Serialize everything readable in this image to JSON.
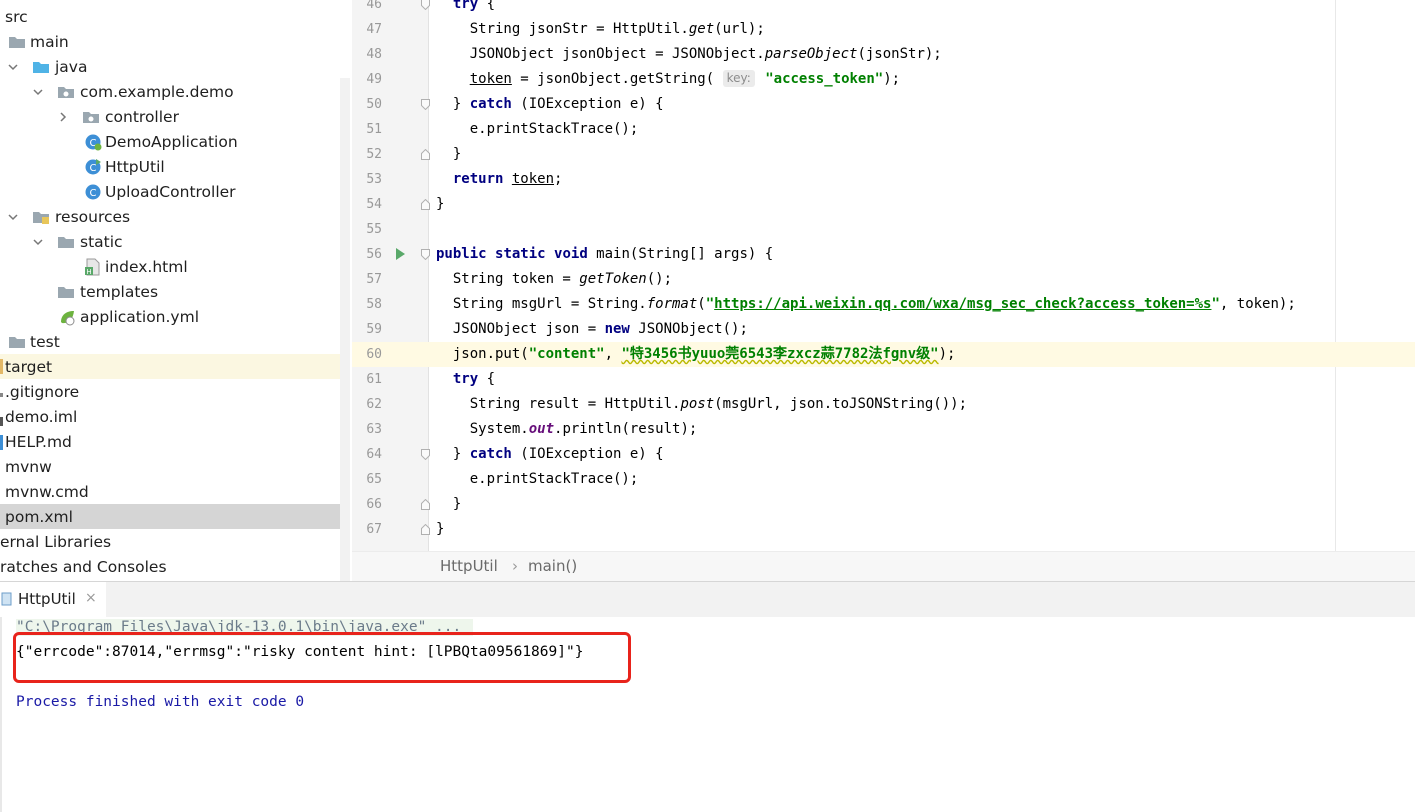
{
  "project_tree": {
    "items": [
      {
        "label": "src",
        "icon": "folder-icon",
        "arrow": ""
      },
      {
        "label": "main",
        "icon": "folder-icon",
        "arrow": ""
      },
      {
        "label": "java",
        "icon": "source-folder-icon",
        "arrow": "down"
      },
      {
        "label": "com.example.demo",
        "icon": "package-icon",
        "arrow": "down"
      },
      {
        "label": "controller",
        "icon": "package-icon",
        "arrow": "right"
      },
      {
        "label": "DemoApplication",
        "icon": "spring-class-icon",
        "arrow": ""
      },
      {
        "label": "HttpUtil",
        "icon": "runnable-class-icon",
        "arrow": ""
      },
      {
        "label": "UploadController",
        "icon": "class-icon",
        "arrow": ""
      },
      {
        "label": "resources",
        "icon": "resources-folder-icon",
        "arrow": "down"
      },
      {
        "label": "static",
        "icon": "folder-icon",
        "arrow": "down"
      },
      {
        "label": "index.html",
        "icon": "html-file-icon",
        "arrow": ""
      },
      {
        "label": "templates",
        "icon": "folder-icon",
        "arrow": ""
      },
      {
        "label": "application.yml",
        "icon": "yaml-file-icon",
        "arrow": ""
      },
      {
        "label": "test",
        "icon": "folder-icon",
        "arrow": ""
      },
      {
        "label": "target",
        "icon": "excluded-folder-icon",
        "arrow": ""
      },
      {
        "label": ".gitignore",
        "icon": "file-icon",
        "arrow": ""
      },
      {
        "label": "demo.iml",
        "icon": "module-file-icon",
        "arrow": ""
      },
      {
        "label": "HELP.md",
        "icon": "markdown-file-icon",
        "arrow": ""
      },
      {
        "label": "mvnw",
        "icon": "file-icon",
        "arrow": ""
      },
      {
        "label": "mvnw.cmd",
        "icon": "file-icon",
        "arrow": ""
      },
      {
        "label": "pom.xml",
        "icon": "maven-file-icon",
        "arrow": ""
      },
      {
        "label": "ernal Libraries",
        "icon": "library-icon",
        "arrow": ""
      },
      {
        "label": "ratches and Consoles",
        "icon": "scratch-icon",
        "arrow": ""
      }
    ]
  },
  "editor": {
    "current_line": "60",
    "lines": [
      {
        "num": "46",
        "text": "      try {"
      },
      {
        "num": "47",
        "text": "        String jsonStr = HttpUtil.get(url);"
      },
      {
        "num": "48",
        "text": "        JSONObject jsonObject = JSONObject.parseObject(jsonStr);"
      },
      {
        "num": "49",
        "text": "        token = jsonObject.getString( key: \"access_token\");"
      },
      {
        "num": "50",
        "text": "      } catch (IOException e) {"
      },
      {
        "num": "51",
        "text": "        e.printStackTrace();"
      },
      {
        "num": "52",
        "text": "      }"
      },
      {
        "num": "53",
        "text": "      return token;"
      },
      {
        "num": "54",
        "text": "    }"
      },
      {
        "num": "55",
        "text": ""
      },
      {
        "num": "56",
        "text": "    public static void main(String[] args) {"
      },
      {
        "num": "57",
        "text": "      String token = getToken();"
      },
      {
        "num": "58",
        "text": "      String msgUrl = String.format(\"https://api.weixin.qq.com/wxa/msg_sec_check?access_token=%s\", token);"
      },
      {
        "num": "59",
        "text": "      JSONObject json = new JSONObject();"
      },
      {
        "num": "60",
        "text": "      json.put(\"content\", \"特3456书yuuo莞6543李zxcz蒜7782法fgnv级\");"
      },
      {
        "num": "61",
        "text": "      try {"
      },
      {
        "num": "62",
        "text": "        String result = HttpUtil.post(msgUrl, json.toJSONString());"
      },
      {
        "num": "63",
        "text": "        System.out.println(result);"
      },
      {
        "num": "64",
        "text": "      } catch (IOException e) {"
      },
      {
        "num": "65",
        "text": "        e.printStackTrace();"
      },
      {
        "num": "66",
        "text": "      }"
      },
      {
        "num": "67",
        "text": "    }"
      }
    ],
    "param_hint": "key:"
  },
  "breadcrumb": {
    "items": [
      "HttpUtil",
      "main()"
    ],
    "separator": "›"
  },
  "run_panel": {
    "tab_label": "HttpUtil",
    "tab_close": "×",
    "console": [
      "\"C:\\Program Files\\Java\\jdk-13.0.1\\bin\\java.exe\" ...",
      "{\"errcode\":87014,\"errmsg\":\"risky content hint: [lPBQta09561869]\"}",
      "",
      "Process finished with exit code 0"
    ]
  },
  "colors": {
    "keyword": "#000080",
    "string": "#008000",
    "highlight_box": "#e8231b",
    "process_text": "#1a1aa6"
  }
}
